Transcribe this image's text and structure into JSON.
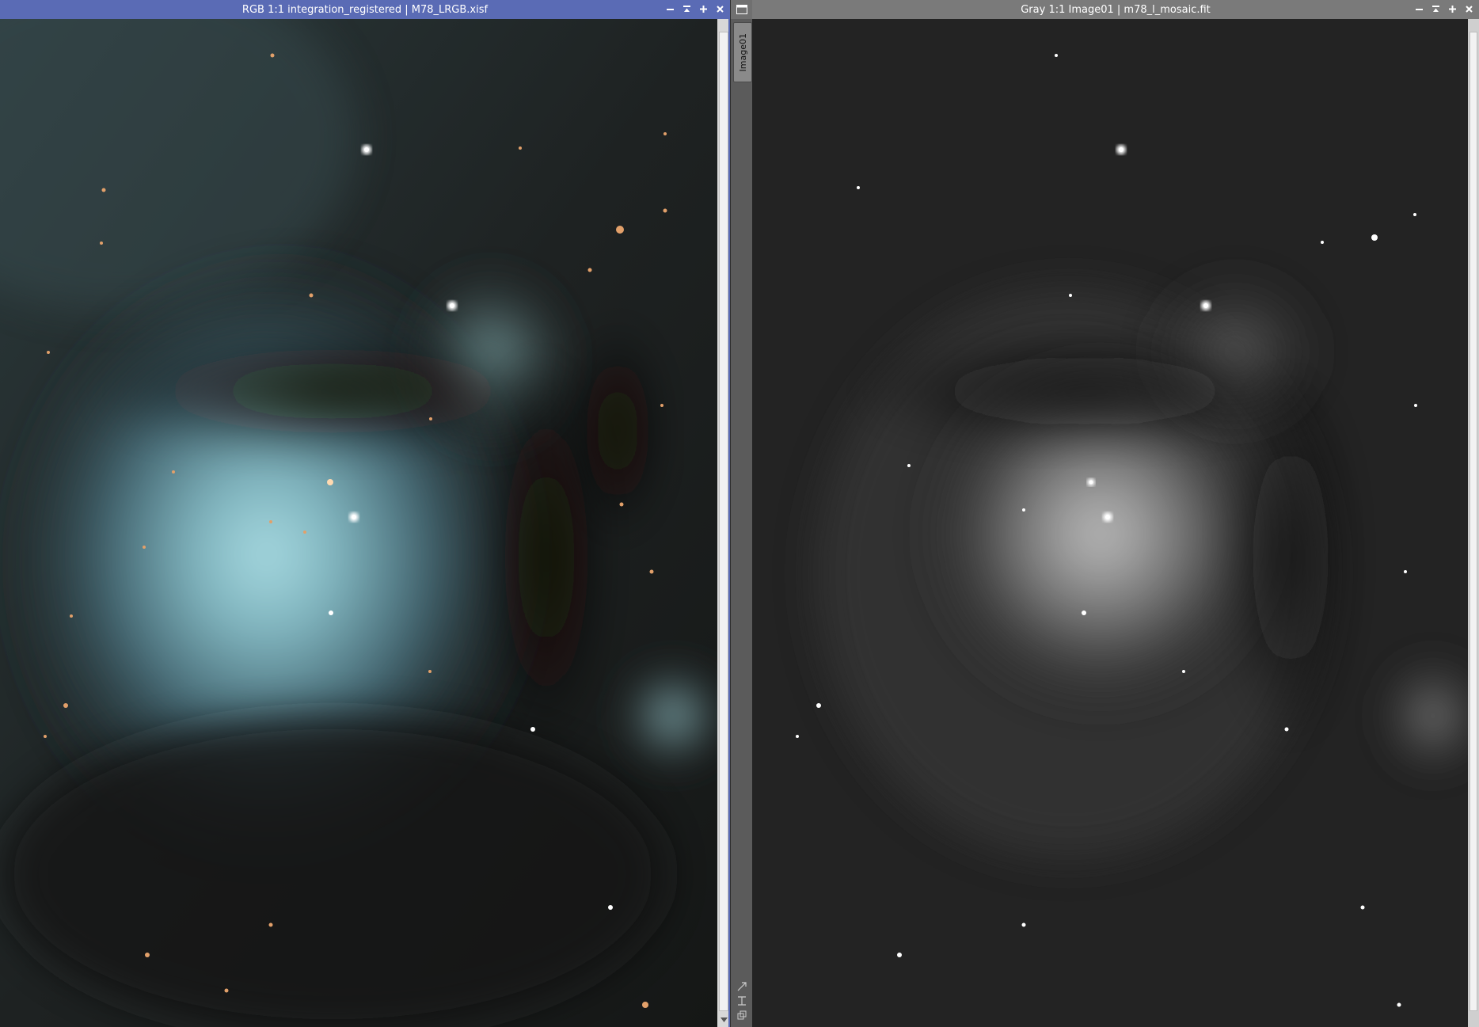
{
  "left_window": {
    "title": "RGB 1:1 integration_registered | M78_LRGB.xisf",
    "accent": "#5a6bb5",
    "image_color_mode": "RGB",
    "buttons": [
      "minimize-icon",
      "shade-icon",
      "maximize-icon",
      "close-icon"
    ]
  },
  "right_window": {
    "title": "Gray 1:1 Image01 | m78_l_mosaic.fit",
    "accent": "#7a7a7a",
    "image_color_mode": "Gray",
    "buttons": [
      "minimize-icon",
      "shade-icon",
      "maximize-icon",
      "close-icon"
    ]
  },
  "side_strip": {
    "tab_label": "Image01"
  }
}
